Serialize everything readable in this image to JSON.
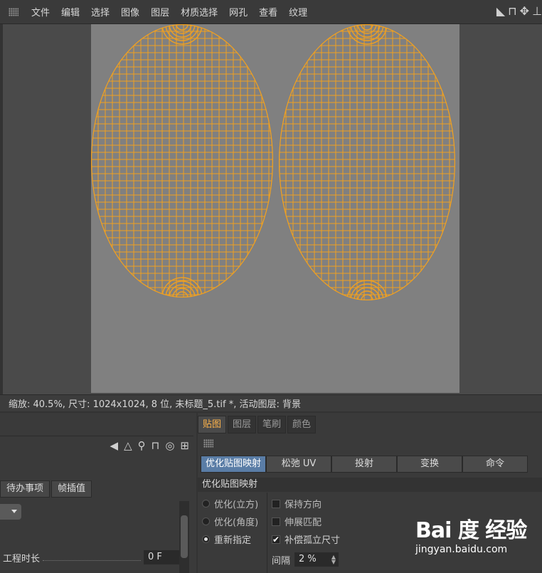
{
  "menubar": {
    "items": [
      "文件",
      "编辑",
      "选择",
      "图像",
      "图层",
      "材质选择",
      "网孔",
      "查看",
      "纹理"
    ]
  },
  "statusbar": {
    "text": "缩放: 40.5%, 尺寸: 1024x1024, 8 位, 未标题_5.tif *, 活动图层: 背景"
  },
  "left_panel": {
    "tabs": [
      "待办事项",
      "帧插值"
    ],
    "project_length_label": "工程时长",
    "project_length_value": "0 F"
  },
  "right_panel": {
    "tabs": [
      "贴图",
      "图层",
      "笔刷",
      "颜色"
    ],
    "buttons": [
      "优化贴图映射",
      "松弛 UV",
      "投射",
      "变换",
      "命令"
    ],
    "section_title": "优化贴图映射",
    "radios": [
      {
        "label": "优化(立方)",
        "selected": false
      },
      {
        "label": "优化(角度)",
        "selected": false
      },
      {
        "label": "重新指定",
        "selected": true
      }
    ],
    "checkboxes": [
      {
        "label": "保持方向",
        "checked": false
      },
      {
        "label": "伸展匹配",
        "checked": false
      },
      {
        "label": "补偿孤立尺寸",
        "checked": true
      }
    ],
    "gap_label": "间隔",
    "gap_value": "2 %"
  },
  "watermark": {
    "logo": "Bai 度 经验",
    "url": "jingyan.baidu.com"
  },
  "colors": {
    "uv_mesh": "#f0a020",
    "canvas": "#808080",
    "active_tab": "#ffb44a",
    "active_button": "#5a7da6"
  }
}
